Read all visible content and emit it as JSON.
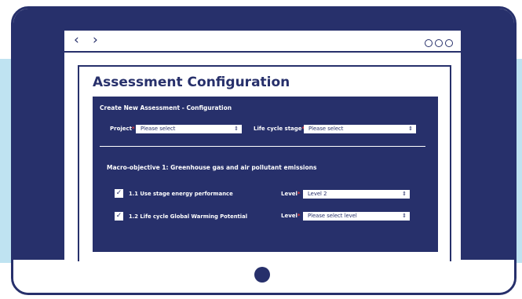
{
  "browser": {
    "back_icon": "chevron-left-icon",
    "forward_icon": "chevron-right-icon",
    "menu_icon": "three-circles-icon"
  },
  "page": {
    "title": "Assessment Configuration"
  },
  "form": {
    "heading": "Create New Assessment - Configuration",
    "project": {
      "label": "Project",
      "required_mark": "*",
      "value": "Please select"
    },
    "life_cycle_stage": {
      "label": "Life cycle stage",
      "required_mark": "*",
      "value": "Please select"
    }
  },
  "macro_objective": {
    "heading": "Macro-objective 1: Greenhouse gas and air pollutant emissions",
    "criteria": [
      {
        "checked": true,
        "label": "1.1 Use stage energy performance",
        "level_label": "Level",
        "required_mark": "*",
        "level_value": "Level 2"
      },
      {
        "checked": true,
        "label": "1.2 Life cycle Global Warming Potential",
        "level_label": "Level",
        "required_mark": "*",
        "level_value": "Please select level"
      }
    ]
  },
  "colors": {
    "navy": "#27306b",
    "light_blue": "#bfe3f1",
    "required": "#e23a3a"
  }
}
